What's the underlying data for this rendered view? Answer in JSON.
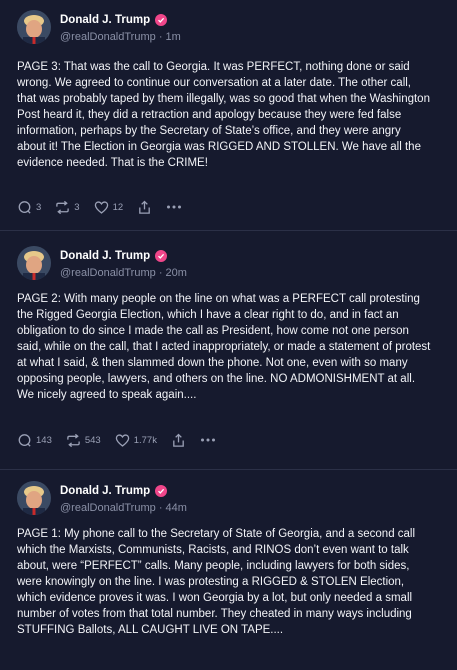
{
  "posts": [
    {
      "author": "Donald J. Trump",
      "handle": "@realDonaldTrump",
      "time": "1m",
      "text": "PAGE 3: That was the call to Georgia. It was PERFECT, nothing done or said wrong. We agreed to continue our conversation at a later date. The other call, that was probably taped by them illegally, was so good that when the Washington Post heard it, they did a retraction and apology because they were fed false information, perhaps by the Secretary of State’s office, and they were angry about it! The Election in Georgia was RIGGED AND STOLLEN. We have all the evidence needed. That is the CRIME!",
      "replies": "3",
      "retruths": "3",
      "likes": "12"
    },
    {
      "author": "Donald J. Trump",
      "handle": "@realDonaldTrump",
      "time": "20m",
      "text": "PAGE 2: With many people on the line on what was a PERFECT call protesting the Rigged Georgia Election, which I have a clear right to do, and in fact an obligation to do since I made the call as President, how come not one person said, while on the call, that I acted inappropriately, or made a statement of protest at what I said, & then slammed down the phone. Not one, even with so many opposing people, lawyers, and others on the line. NO ADMONISHMENT at all. We nicely  agreed to speak again....",
      "replies": "143",
      "retruths": "543",
      "likes": "1.77k"
    },
    {
      "author": "Donald J. Trump",
      "handle": "@realDonaldTrump",
      "time": "44m",
      "text": "PAGE 1: My phone call to the Secretary of State of Georgia, and a second call which the Marxists, Communists, Racists, and RINOS don’t even want to talk about, were “PERFECT” calls. Many people, including lawyers for both sides, were knowingly on the line. I was protesting a RIGGED & STOLEN Election, which evidence proves it was. I won Georgia by a lot, but only needed a small number of votes from that total number. They cheated in many ways including STUFFING Ballots, ALL CAUGHT LIVE ON TAPE...."
    }
  ],
  "separator": "·",
  "icons": {
    "reply": "reply-icon",
    "retruth": "retruth-icon",
    "like": "heart-icon",
    "share": "share-icon",
    "more": "more-icon",
    "verified": "verified-check-icon"
  },
  "colors": {
    "background": "#161a2e",
    "verified": "#f0468a",
    "muted": "#8a90a6"
  }
}
